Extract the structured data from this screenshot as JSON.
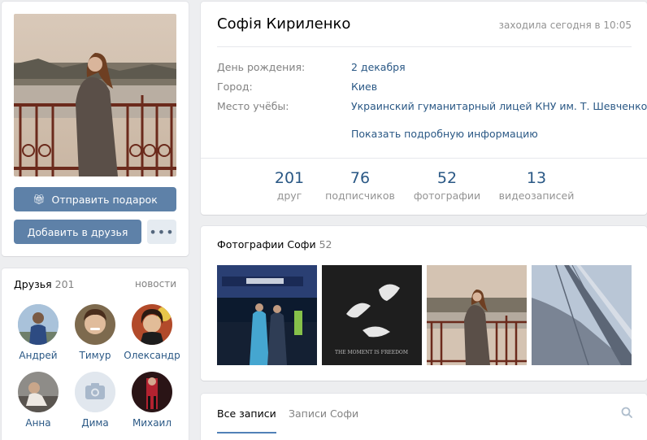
{
  "profile": {
    "name": "Софія Кириленко",
    "last_seen": "заходила сегодня в 10:05",
    "info": [
      {
        "label": "День рождения:",
        "value": "2 декабря"
      },
      {
        "label": "Город:",
        "value": "Киев"
      },
      {
        "label": "Место учёбы:",
        "value": "Украинский гуманитарный лицей КНУ им. Т. Шевченко"
      }
    ],
    "details_link": "Показать подробную информацию",
    "counters": [
      {
        "num": "201",
        "label": "друг"
      },
      {
        "num": "76",
        "label": "подписчиков"
      },
      {
        "num": "52",
        "label": "фотографии"
      },
      {
        "num": "13",
        "label": "видеозаписей"
      }
    ]
  },
  "actions": {
    "gift": "Отправить подарок",
    "add_friend": "Добавить в друзья",
    "more": "•••"
  },
  "friends": {
    "title": "Друзья",
    "count": "201",
    "news": "новости",
    "items": [
      {
        "name": "Андрей"
      },
      {
        "name": "Тимур"
      },
      {
        "name": "Олександр"
      },
      {
        "name": "Анна"
      },
      {
        "name": "Дима"
      },
      {
        "name": "Михаил"
      }
    ]
  },
  "photos": {
    "title": "Фотографии Софи",
    "count": "52",
    "thumb2_caption": "THE MOMENT IS FREEDOM"
  },
  "wall": {
    "tab_all": "Все записи",
    "tab_own": "Записи Софи"
  },
  "colors": {
    "accent": "#5e81a8",
    "link": "#2a5885",
    "background": "#edeef0"
  }
}
